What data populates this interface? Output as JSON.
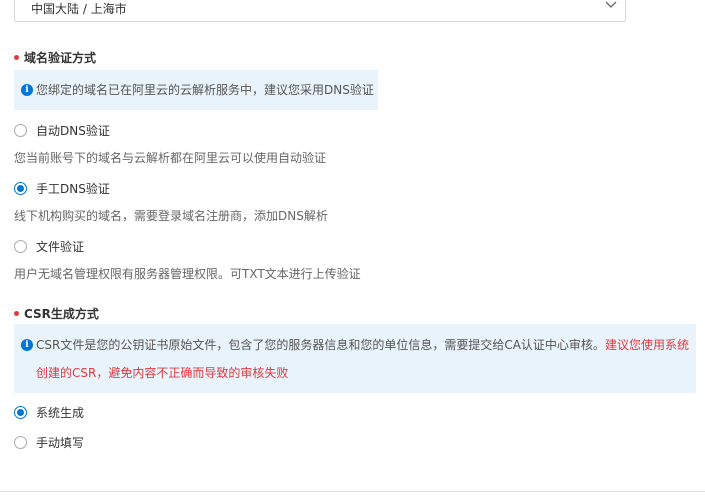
{
  "region_select": {
    "value": "中国大陆 / 上海市",
    "arrow_icon": "chevron-down-icon"
  },
  "domain_verify": {
    "title": "域名验证方式",
    "notice": "您绑定的域名已在阿里云的云解析服务中，建议您采用DNS验证",
    "options": [
      {
        "label": "自动DNS验证",
        "desc": "您当前账号下的域名与云解析都在阿里云可以使用自动验证",
        "checked": false
      },
      {
        "label": "手工DNS验证",
        "desc": "线下机构购买的域名，需要登录域名注册商，添加DNS解析",
        "checked": true
      },
      {
        "label": "文件验证",
        "desc": "用户无域名管理权限有服务器管理权限。可TXT文本进行上传验证",
        "checked": false
      }
    ]
  },
  "csr": {
    "title": "CSR生成方式",
    "notice_normal": "CSR文件是您的公钥证书原始文件，包含了您的服务器信息和您的单位信息，需要提交给CA认证中心审核。",
    "notice_warning": "建议您使用系统创建的CSR，避免内容不正确而导致的审核失败",
    "options": [
      {
        "label": "系统生成",
        "checked": true
      },
      {
        "label": "手动填写",
        "checked": false
      }
    ]
  },
  "colors": {
    "accent": "#0075d3",
    "required_dot": "#e0393e",
    "notice_bg": "#e9f3fc",
    "warning_text": "#e0393e"
  }
}
